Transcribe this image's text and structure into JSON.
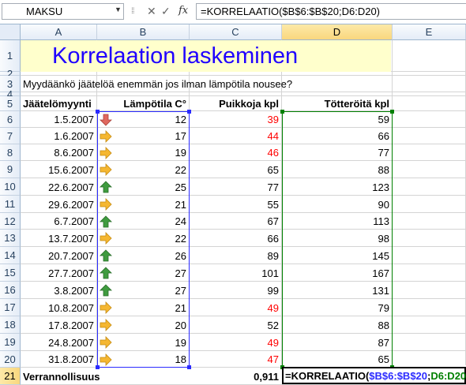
{
  "formula_bar": {
    "namebox": "MAKSU",
    "formula": "=KORRELAATIO($B$6:$B$20;D6:D20)"
  },
  "columns": [
    "A",
    "B",
    "C",
    "D",
    "E"
  ],
  "rows": [
    "1",
    "2",
    "3",
    "4",
    "5",
    "6",
    "7",
    "8",
    "9",
    "10",
    "11",
    "12",
    "13",
    "14",
    "15",
    "16",
    "17",
    "18",
    "19",
    "20",
    "21"
  ],
  "title": "Korrelaation laskeminen",
  "question": "Myydäänkö jäätelöä enemmän jos ilman lämpötila nousee?",
  "headers": {
    "a": "Jäätelömyynti",
    "b": "Lämpötila C°",
    "c": "Puikkoja kpl",
    "d": "Tötteröitä kpl"
  },
  "data_rows": [
    {
      "date": "1.5.2007",
      "temp": "12",
      "arrow": "down",
      "puikot": "39",
      "red": true,
      "totterot": "59"
    },
    {
      "date": "1.6.2007",
      "temp": "17",
      "arrow": "right",
      "puikot": "44",
      "red": true,
      "totterot": "66"
    },
    {
      "date": "8.6.2007",
      "temp": "19",
      "arrow": "right",
      "puikot": "46",
      "red": true,
      "totterot": "77"
    },
    {
      "date": "15.6.2007",
      "temp": "22",
      "arrow": "right",
      "puikot": "65",
      "red": false,
      "totterot": "88"
    },
    {
      "date": "22.6.2007",
      "temp": "25",
      "arrow": "up",
      "puikot": "77",
      "red": false,
      "totterot": "123"
    },
    {
      "date": "29.6.2007",
      "temp": "21",
      "arrow": "right",
      "puikot": "55",
      "red": false,
      "totterot": "90"
    },
    {
      "date": "6.7.2007",
      "temp": "24",
      "arrow": "up",
      "puikot": "67",
      "red": false,
      "totterot": "113"
    },
    {
      "date": "13.7.2007",
      "temp": "22",
      "arrow": "right",
      "puikot": "66",
      "red": false,
      "totterot": "98"
    },
    {
      "date": "20.7.2007",
      "temp": "26",
      "arrow": "up",
      "puikot": "89",
      "red": false,
      "totterot": "145"
    },
    {
      "date": "27.7.2007",
      "temp": "27",
      "arrow": "up",
      "puikot": "101",
      "red": false,
      "totterot": "167"
    },
    {
      "date": "3.8.2007",
      "temp": "27",
      "arrow": "up",
      "puikot": "99",
      "red": false,
      "totterot": "131"
    },
    {
      "date": "10.8.2007",
      "temp": "21",
      "arrow": "right",
      "puikot": "49",
      "red": true,
      "totterot": "79"
    },
    {
      "date": "17.8.2007",
      "temp": "20",
      "arrow": "right",
      "puikot": "52",
      "red": false,
      "totterot": "88"
    },
    {
      "date": "24.8.2007",
      "temp": "19",
      "arrow": "right",
      "puikot": "49",
      "red": true,
      "totterot": "87"
    },
    {
      "date": "31.8.2007",
      "temp": "18",
      "arrow": "right",
      "puikot": "47",
      "red": true,
      "totterot": "65"
    }
  ],
  "result_row": {
    "label": "Verrannollisuus",
    "value": "0,911",
    "edit_prefix": "=KORRELAATIO(",
    "edit_range1": "$B$6:$B$20",
    "edit_sep": ";",
    "edit_range2": "D6:D20",
    "edit_suffix": ")"
  },
  "colors": {
    "title": "#1f00ff",
    "title_band": "#ffffcc",
    "red_values": "#ff0000",
    "range_blue": "#2b2bff",
    "range_green": "#008000",
    "arrow_up": "#3f9b3f",
    "arrow_right": "#f5b731",
    "arrow_down": "#e0685f"
  }
}
